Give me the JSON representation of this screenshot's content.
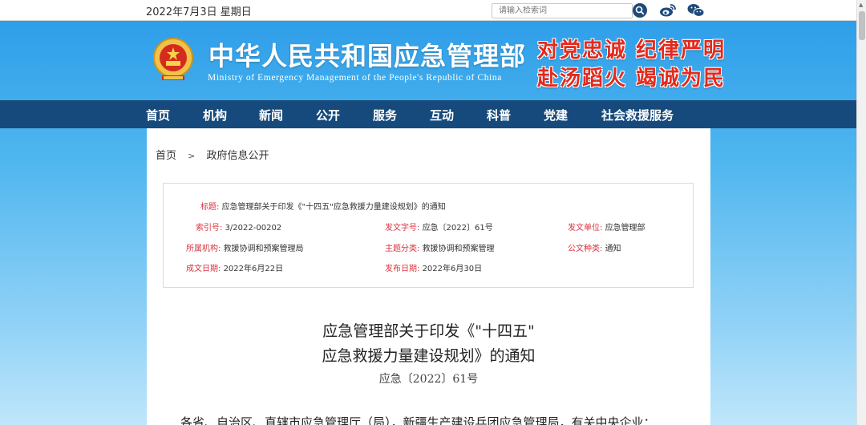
{
  "topbar": {
    "date": "2022年7月3日 星期日",
    "search_placeholder": "请输入检索词"
  },
  "header": {
    "title": "中华人民共和国应急管理部",
    "subtitle": "Ministry of Emergency Management of the People's Republic of China",
    "slogan_line1": "对党忠诚 纪律严明",
    "slogan_line2": "赴汤蹈火 竭诚为民"
  },
  "nav": {
    "items": [
      "首页",
      "机构",
      "新闻",
      "公开",
      "服务",
      "互动",
      "科普",
      "党建",
      "社会救援服务"
    ]
  },
  "breadcrumb": {
    "home": "首页",
    "separator": ">",
    "current": "政府信息公开"
  },
  "meta": {
    "title_label": "标题:",
    "title_value": "应急管理部关于印发《\"十四五\"应急救援力量建设规划》的通知",
    "index_label": "索引号:",
    "index_value": "3/2022-00202",
    "doc_no_label": "发文字号:",
    "doc_no_value": "应急〔2022〕61号",
    "issuer_label": "发文单位:",
    "issuer_value": "应急管理部",
    "dept_label": "所属机构:",
    "dept_value": "救援协调和预案管理局",
    "category_label": "主题分类:",
    "category_value": "救援协调和预案管理",
    "type_label": "公文种类:",
    "type_value": "通知",
    "created_label": "成文日期:",
    "created_value": "2022年6月22日",
    "published_label": "发布日期:",
    "published_value": "2022年6月30日"
  },
  "document": {
    "title_line1": "应急管理部关于印发《\"十四五\"",
    "title_line2": "应急救援力量建设规划》的通知",
    "number": "应急〔2022〕61号",
    "body_start": "各省、自治区、直辖市应急管理厅（局），新疆生产建设兵团应急管理局，有关中央企业："
  },
  "colors": {
    "nav_bg": "#174a7c",
    "label_red": "#d9333f",
    "slogan_red": "#e22a1d"
  },
  "icons": [
    "search-icon",
    "weibo-icon",
    "wechat-icon",
    "national-emblem"
  ]
}
